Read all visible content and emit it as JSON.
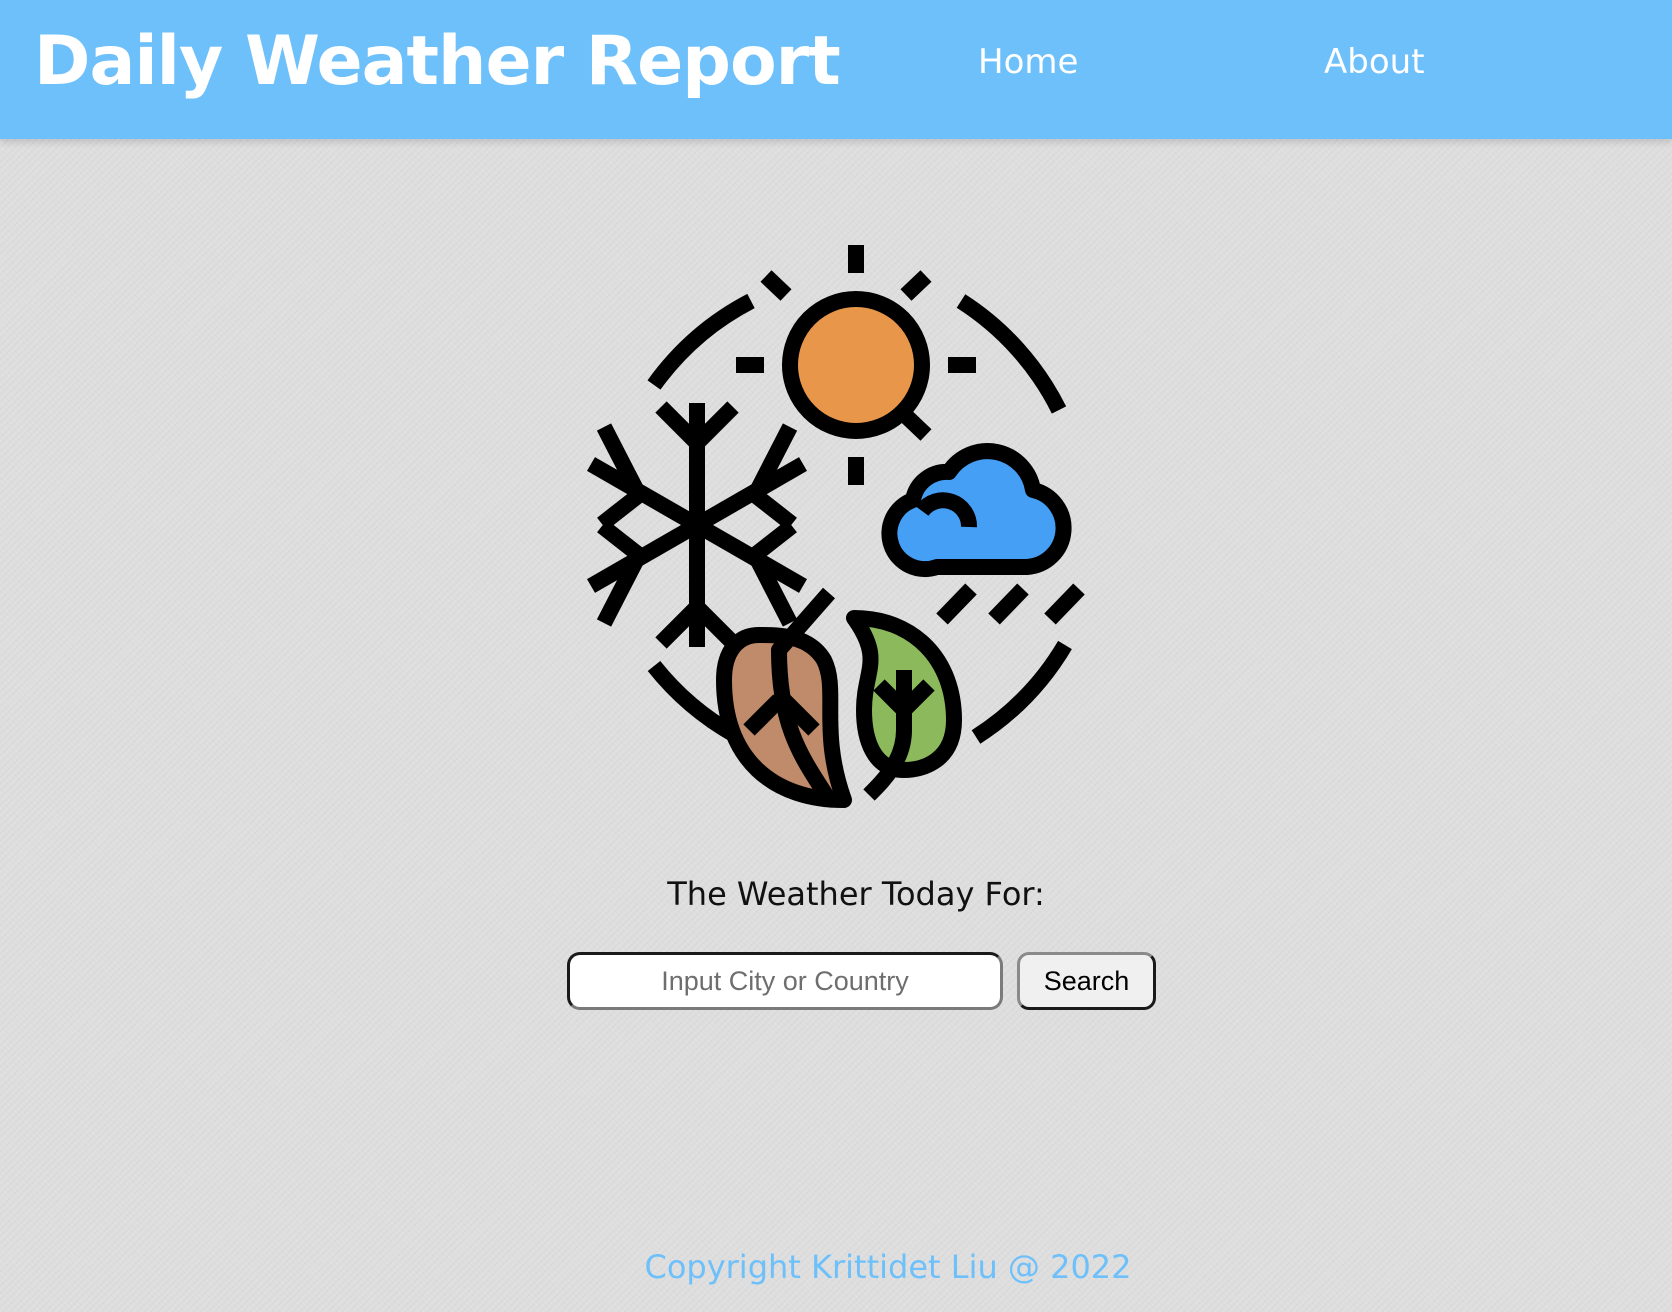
{
  "header": {
    "brand": "Daily Weather Report",
    "nav": {
      "home": "Home",
      "about": "About"
    },
    "background_color": "#6ec0fb"
  },
  "hero": {
    "icon": "four-seasons-weather-icon",
    "prompt": "The Weather Today For:"
  },
  "search": {
    "placeholder": "Input City or Country",
    "value": "",
    "button_label": "Search"
  },
  "footer": {
    "copyright": "Copyright Krittidet Liu @ 2022"
  },
  "colors": {
    "accent": "#6ec0fb",
    "sun": "#e8974a",
    "cloud": "#459ff5",
    "leaf_brown": "#bf8b6a",
    "leaf_green": "#8cb95c",
    "page_background": "#dedede"
  }
}
